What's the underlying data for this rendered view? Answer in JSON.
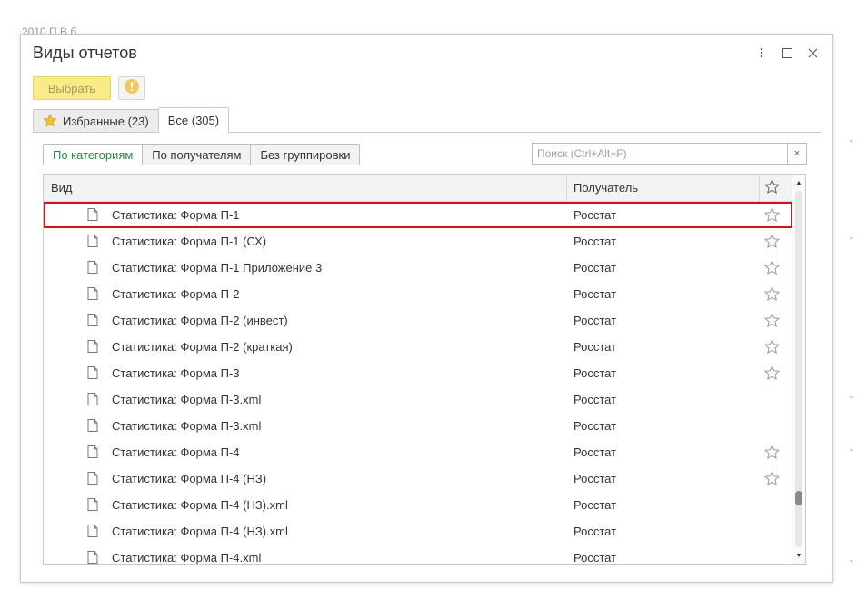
{
  "background": {
    "top_text": "2010          П          В  б"
  },
  "window": {
    "title": "Виды отчетов"
  },
  "toolbar": {
    "choose_label": "Выбрать"
  },
  "tabs": [
    {
      "label": "Избранные (23)",
      "active": false
    },
    {
      "label": "Все (305)",
      "active": true
    }
  ],
  "grouping": [
    {
      "label": "По категориям",
      "active": true
    },
    {
      "label": "По получателям",
      "active": false
    },
    {
      "label": "Без группировки",
      "active": false
    }
  ],
  "search": {
    "placeholder": "Поиск (Ctrl+Alt+F)",
    "value": "",
    "clear_label": "×"
  },
  "grid": {
    "columns": {
      "vid": "Вид",
      "recipient": "Получатель"
    },
    "rows": [
      {
        "name": "Статистика: Форма П-1",
        "recipient": "Росстат",
        "star": true,
        "selected": true
      },
      {
        "name": "Статистика: Форма П-1 (СХ)",
        "recipient": "Росстат",
        "star": true,
        "selected": false
      },
      {
        "name": "Статистика: Форма П-1 Приложение 3",
        "recipient": "Росстат",
        "star": true,
        "selected": false
      },
      {
        "name": "Статистика: Форма П-2",
        "recipient": "Росстат",
        "star": true,
        "selected": false
      },
      {
        "name": "Статистика: Форма П-2 (инвест)",
        "recipient": "Росстат",
        "star": true,
        "selected": false
      },
      {
        "name": "Статистика: Форма П-2 (краткая)",
        "recipient": "Росстат",
        "star": true,
        "selected": false
      },
      {
        "name": "Статистика: Форма П-3",
        "recipient": "Росстат",
        "star": true,
        "selected": false
      },
      {
        "name": "Статистика: Форма П-3.xml",
        "recipient": "Росстат",
        "star": false,
        "selected": false
      },
      {
        "name": "Статистика: Форма П-3.xml",
        "recipient": "Росстат",
        "star": false,
        "selected": false
      },
      {
        "name": "Статистика: Форма П-4",
        "recipient": "Росстат",
        "star": true,
        "selected": false
      },
      {
        "name": "Статистика: Форма П-4 (НЗ)",
        "recipient": "Росстат",
        "star": true,
        "selected": false
      },
      {
        "name": "Статистика: Форма П-4 (НЗ).xml",
        "recipient": "Росстат",
        "star": false,
        "selected": false
      },
      {
        "name": "Статистика: Форма П-4 (НЗ).xml",
        "recipient": "Росстат",
        "star": false,
        "selected": false
      },
      {
        "name": "Статистика: Форма П-4.xml",
        "recipient": "Росстат",
        "star": false,
        "selected": false
      }
    ]
  },
  "colors": {
    "accent_green": "#2a8a47",
    "choose_button_bg": "#fbeb88",
    "selection_border": "#d0121b",
    "favorite_star": "#f2c230"
  },
  "icons": {
    "window_menu": "more-vertical-icon",
    "window_maximize": "maximize-icon",
    "window_close": "close-icon",
    "info": "info-icon",
    "favorites_tab": "star-filled-icon",
    "row_document": "document-icon",
    "row_favorite": "star-outline-icon"
  }
}
